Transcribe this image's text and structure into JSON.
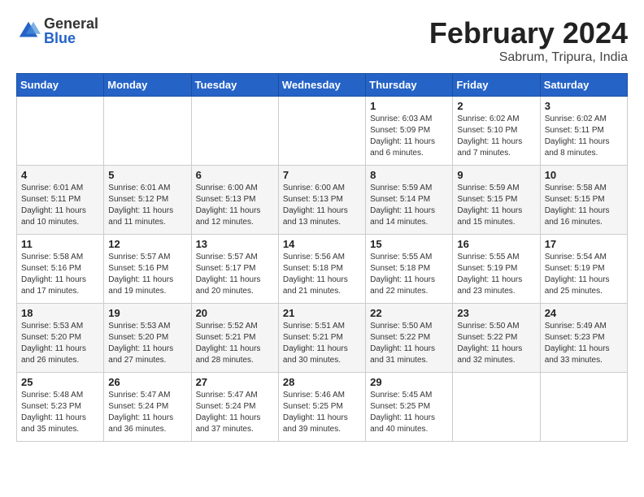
{
  "logo": {
    "general": "General",
    "blue": "Blue"
  },
  "header": {
    "month": "February 2024",
    "location": "Sabrum, Tripura, India"
  },
  "weekdays": [
    "Sunday",
    "Monday",
    "Tuesday",
    "Wednesday",
    "Thursday",
    "Friday",
    "Saturday"
  ],
  "weeks": [
    [
      {
        "day": "",
        "info": ""
      },
      {
        "day": "",
        "info": ""
      },
      {
        "day": "",
        "info": ""
      },
      {
        "day": "",
        "info": ""
      },
      {
        "day": "1",
        "info": "Sunrise: 6:03 AM\nSunset: 5:09 PM\nDaylight: 11 hours and 6 minutes."
      },
      {
        "day": "2",
        "info": "Sunrise: 6:02 AM\nSunset: 5:10 PM\nDaylight: 11 hours and 7 minutes."
      },
      {
        "day": "3",
        "info": "Sunrise: 6:02 AM\nSunset: 5:11 PM\nDaylight: 11 hours and 8 minutes."
      }
    ],
    [
      {
        "day": "4",
        "info": "Sunrise: 6:01 AM\nSunset: 5:11 PM\nDaylight: 11 hours and 10 minutes."
      },
      {
        "day": "5",
        "info": "Sunrise: 6:01 AM\nSunset: 5:12 PM\nDaylight: 11 hours and 11 minutes."
      },
      {
        "day": "6",
        "info": "Sunrise: 6:00 AM\nSunset: 5:13 PM\nDaylight: 11 hours and 12 minutes."
      },
      {
        "day": "7",
        "info": "Sunrise: 6:00 AM\nSunset: 5:13 PM\nDaylight: 11 hours and 13 minutes."
      },
      {
        "day": "8",
        "info": "Sunrise: 5:59 AM\nSunset: 5:14 PM\nDaylight: 11 hours and 14 minutes."
      },
      {
        "day": "9",
        "info": "Sunrise: 5:59 AM\nSunset: 5:15 PM\nDaylight: 11 hours and 15 minutes."
      },
      {
        "day": "10",
        "info": "Sunrise: 5:58 AM\nSunset: 5:15 PM\nDaylight: 11 hours and 16 minutes."
      }
    ],
    [
      {
        "day": "11",
        "info": "Sunrise: 5:58 AM\nSunset: 5:16 PM\nDaylight: 11 hours and 17 minutes."
      },
      {
        "day": "12",
        "info": "Sunrise: 5:57 AM\nSunset: 5:16 PM\nDaylight: 11 hours and 19 minutes."
      },
      {
        "day": "13",
        "info": "Sunrise: 5:57 AM\nSunset: 5:17 PM\nDaylight: 11 hours and 20 minutes."
      },
      {
        "day": "14",
        "info": "Sunrise: 5:56 AM\nSunset: 5:18 PM\nDaylight: 11 hours and 21 minutes."
      },
      {
        "day": "15",
        "info": "Sunrise: 5:55 AM\nSunset: 5:18 PM\nDaylight: 11 hours and 22 minutes."
      },
      {
        "day": "16",
        "info": "Sunrise: 5:55 AM\nSunset: 5:19 PM\nDaylight: 11 hours and 23 minutes."
      },
      {
        "day": "17",
        "info": "Sunrise: 5:54 AM\nSunset: 5:19 PM\nDaylight: 11 hours and 25 minutes."
      }
    ],
    [
      {
        "day": "18",
        "info": "Sunrise: 5:53 AM\nSunset: 5:20 PM\nDaylight: 11 hours and 26 minutes."
      },
      {
        "day": "19",
        "info": "Sunrise: 5:53 AM\nSunset: 5:20 PM\nDaylight: 11 hours and 27 minutes."
      },
      {
        "day": "20",
        "info": "Sunrise: 5:52 AM\nSunset: 5:21 PM\nDaylight: 11 hours and 28 minutes."
      },
      {
        "day": "21",
        "info": "Sunrise: 5:51 AM\nSunset: 5:21 PM\nDaylight: 11 hours and 30 minutes."
      },
      {
        "day": "22",
        "info": "Sunrise: 5:50 AM\nSunset: 5:22 PM\nDaylight: 11 hours and 31 minutes."
      },
      {
        "day": "23",
        "info": "Sunrise: 5:50 AM\nSunset: 5:22 PM\nDaylight: 11 hours and 32 minutes."
      },
      {
        "day": "24",
        "info": "Sunrise: 5:49 AM\nSunset: 5:23 PM\nDaylight: 11 hours and 33 minutes."
      }
    ],
    [
      {
        "day": "25",
        "info": "Sunrise: 5:48 AM\nSunset: 5:23 PM\nDaylight: 11 hours and 35 minutes."
      },
      {
        "day": "26",
        "info": "Sunrise: 5:47 AM\nSunset: 5:24 PM\nDaylight: 11 hours and 36 minutes."
      },
      {
        "day": "27",
        "info": "Sunrise: 5:47 AM\nSunset: 5:24 PM\nDaylight: 11 hours and 37 minutes."
      },
      {
        "day": "28",
        "info": "Sunrise: 5:46 AM\nSunset: 5:25 PM\nDaylight: 11 hours and 39 minutes."
      },
      {
        "day": "29",
        "info": "Sunrise: 5:45 AM\nSunset: 5:25 PM\nDaylight: 11 hours and 40 minutes."
      },
      {
        "day": "",
        "info": ""
      },
      {
        "day": "",
        "info": ""
      }
    ]
  ]
}
